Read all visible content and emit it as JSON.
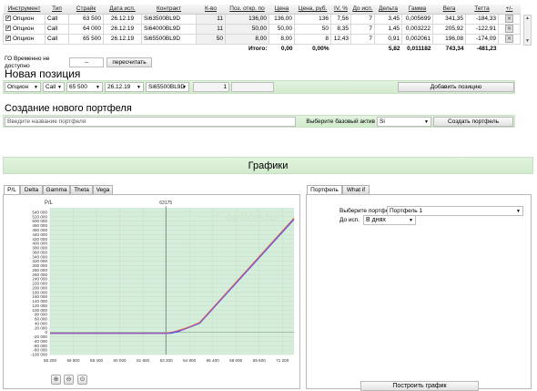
{
  "positions": {
    "headers": [
      "Инструмент",
      "Тип",
      "Страйк",
      "Дата исп.",
      "Контракт",
      "К-во",
      "Поз. откр. по",
      "Цена",
      "Цена, руб.",
      "IV, %",
      "До исп.",
      "Дельта",
      "Гамма",
      "Вега",
      "Тетта",
      "+/-"
    ],
    "rows": [
      {
        "instrument": "Опцион",
        "type": "Call",
        "strike": "63 500",
        "date": "26.12.19",
        "contract": "Si63500BL9D",
        "qty": "11",
        "open": "136,00",
        "price": "136,00",
        "price_rub": "136",
        "iv": "7,56",
        "days": "7",
        "delta": "3,45",
        "gamma": "0,005699",
        "vega": "341,35",
        "theta": "-184,33"
      },
      {
        "instrument": "Опцион",
        "type": "Call",
        "strike": "64 000",
        "date": "26.12.19",
        "contract": "Si64000BL9D",
        "qty": "11",
        "open": "50,00",
        "price": "50,00",
        "price_rub": "50",
        "iv": "8,35",
        "days": "7",
        "delta": "1,45",
        "gamma": "0,003222",
        "vega": "205,92",
        "theta": "-122,91"
      },
      {
        "instrument": "Опцион",
        "type": "Call",
        "strike": "65 500",
        "date": "26.12.19",
        "contract": "Si65500BL9D",
        "qty": "50",
        "open": "8,00",
        "price": "8,00",
        "price_rub": "8",
        "iv": "12,43",
        "days": "7",
        "delta": "0,91",
        "gamma": "0,002061",
        "vega": "196,08",
        "theta": "-174,09"
      }
    ],
    "totals": {
      "label": "Итого:",
      "price": "0,00",
      "price_pct": "0,00%",
      "delta": "5,82",
      "gamma": "0,011182",
      "vega": "743,34",
      "theta": "-481,23"
    }
  },
  "go": {
    "label": "ГО Временно не доступно",
    "value": "--",
    "recalc_label": "пересчитать"
  },
  "new_position": {
    "title": "Новая позиция",
    "instrument": "Опцион",
    "type": "Call",
    "strike": "65 500",
    "date": "26.12.19",
    "contract": "Si65500BL9D",
    "qty": "1",
    "add_label": "Добавить позицию"
  },
  "new_portfolio": {
    "title": "Создание нового портфеля",
    "name_placeholder": "Введите название портфеля",
    "base_label": "Выберите базовый актив",
    "base_value": "Si",
    "create_label": "Создать портфель"
  },
  "charts_section": {
    "title": "Графики"
  },
  "chart_tabs": [
    "P/L",
    "Delta",
    "Gamma",
    "Theta",
    "Vega"
  ],
  "chart_toolbar_icons": [
    "zoom-in-icon",
    "zoom-out-icon",
    "zoom-reset-icon"
  ],
  "chart_data": {
    "type": "line",
    "ylabel": "P/L",
    "watermark": "option.ru",
    "marker_label": "63175",
    "marker_x": 63175,
    "xlim": [
      55200,
      72000
    ],
    "ylim": [
      -100000,
      560000
    ],
    "x_ticks": [
      55200,
      56800,
      58400,
      60000,
      61600,
      63200,
      64800,
      66400,
      68000,
      69600,
      71200
    ],
    "y_ticks": [
      -100000,
      -80000,
      -60000,
      -40000,
      -20000,
      0,
      20000,
      40000,
      60000,
      80000,
      100000,
      120000,
      140000,
      160000,
      180000,
      200000,
      220000,
      240000,
      260000,
      280000,
      300000,
      320000,
      340000,
      360000,
      380000,
      400000,
      420000,
      440000,
      460000,
      480000,
      500000,
      520000,
      540000
    ],
    "x_tick_labels": [
      "55 200",
      "56 800",
      "58 400",
      "60 000",
      "61 600",
      "63 200",
      "64 800",
      "66 400",
      "68 000",
      "69 600",
      "71 200"
    ],
    "y_tick_labels": [
      "-100 000",
      "-80 000",
      "-60 000",
      "-40 000",
      "-20 000",
      "0",
      "20 000",
      "40 000",
      "60 000",
      "80 000",
      "100 000",
      "120 000",
      "140 000",
      "160 000",
      "180 000",
      "200 000",
      "220 000",
      "240 000",
      "260 000",
      "280 000",
      "300 000",
      "320 000",
      "340 000",
      "360 000",
      "380 000",
      "400 000",
      "420 000",
      "440 000",
      "460 000",
      "480 000",
      "500 000",
      "520 000",
      "540 000"
    ],
    "series": [
      {
        "color": "#f0a030",
        "x": [
          55200,
          63200,
          63600,
          64000,
          64800,
          65500,
          72000
        ],
        "y": [
          -4000,
          -4000,
          1000,
          8000,
          25000,
          45000,
          514000
        ]
      },
      {
        "color": "#3355ee",
        "x": [
          55200,
          63500,
          64000,
          65500,
          72000
        ],
        "y": [
          -4000,
          -4000,
          3000,
          40000,
          508000
        ]
      },
      {
        "color": "#a050c0",
        "x": [
          55200,
          63300,
          63800,
          64500,
          65500,
          72000
        ],
        "y": [
          -4000,
          -4000,
          3000,
          15000,
          42000,
          511000
        ]
      }
    ]
  },
  "side_tabs": [
    "Портфель",
    "What if"
  ],
  "side_panel": {
    "portfolio_label": "Выберите портфель",
    "portfolio_value": "Портфель 1",
    "days_label": "До исп.",
    "days_value": "В днях",
    "build_label": "Построить график"
  },
  "colors": {
    "accent_green": "#d7eed3",
    "plot_fill": "#d5eedc",
    "grid": "#c8dcc8"
  }
}
